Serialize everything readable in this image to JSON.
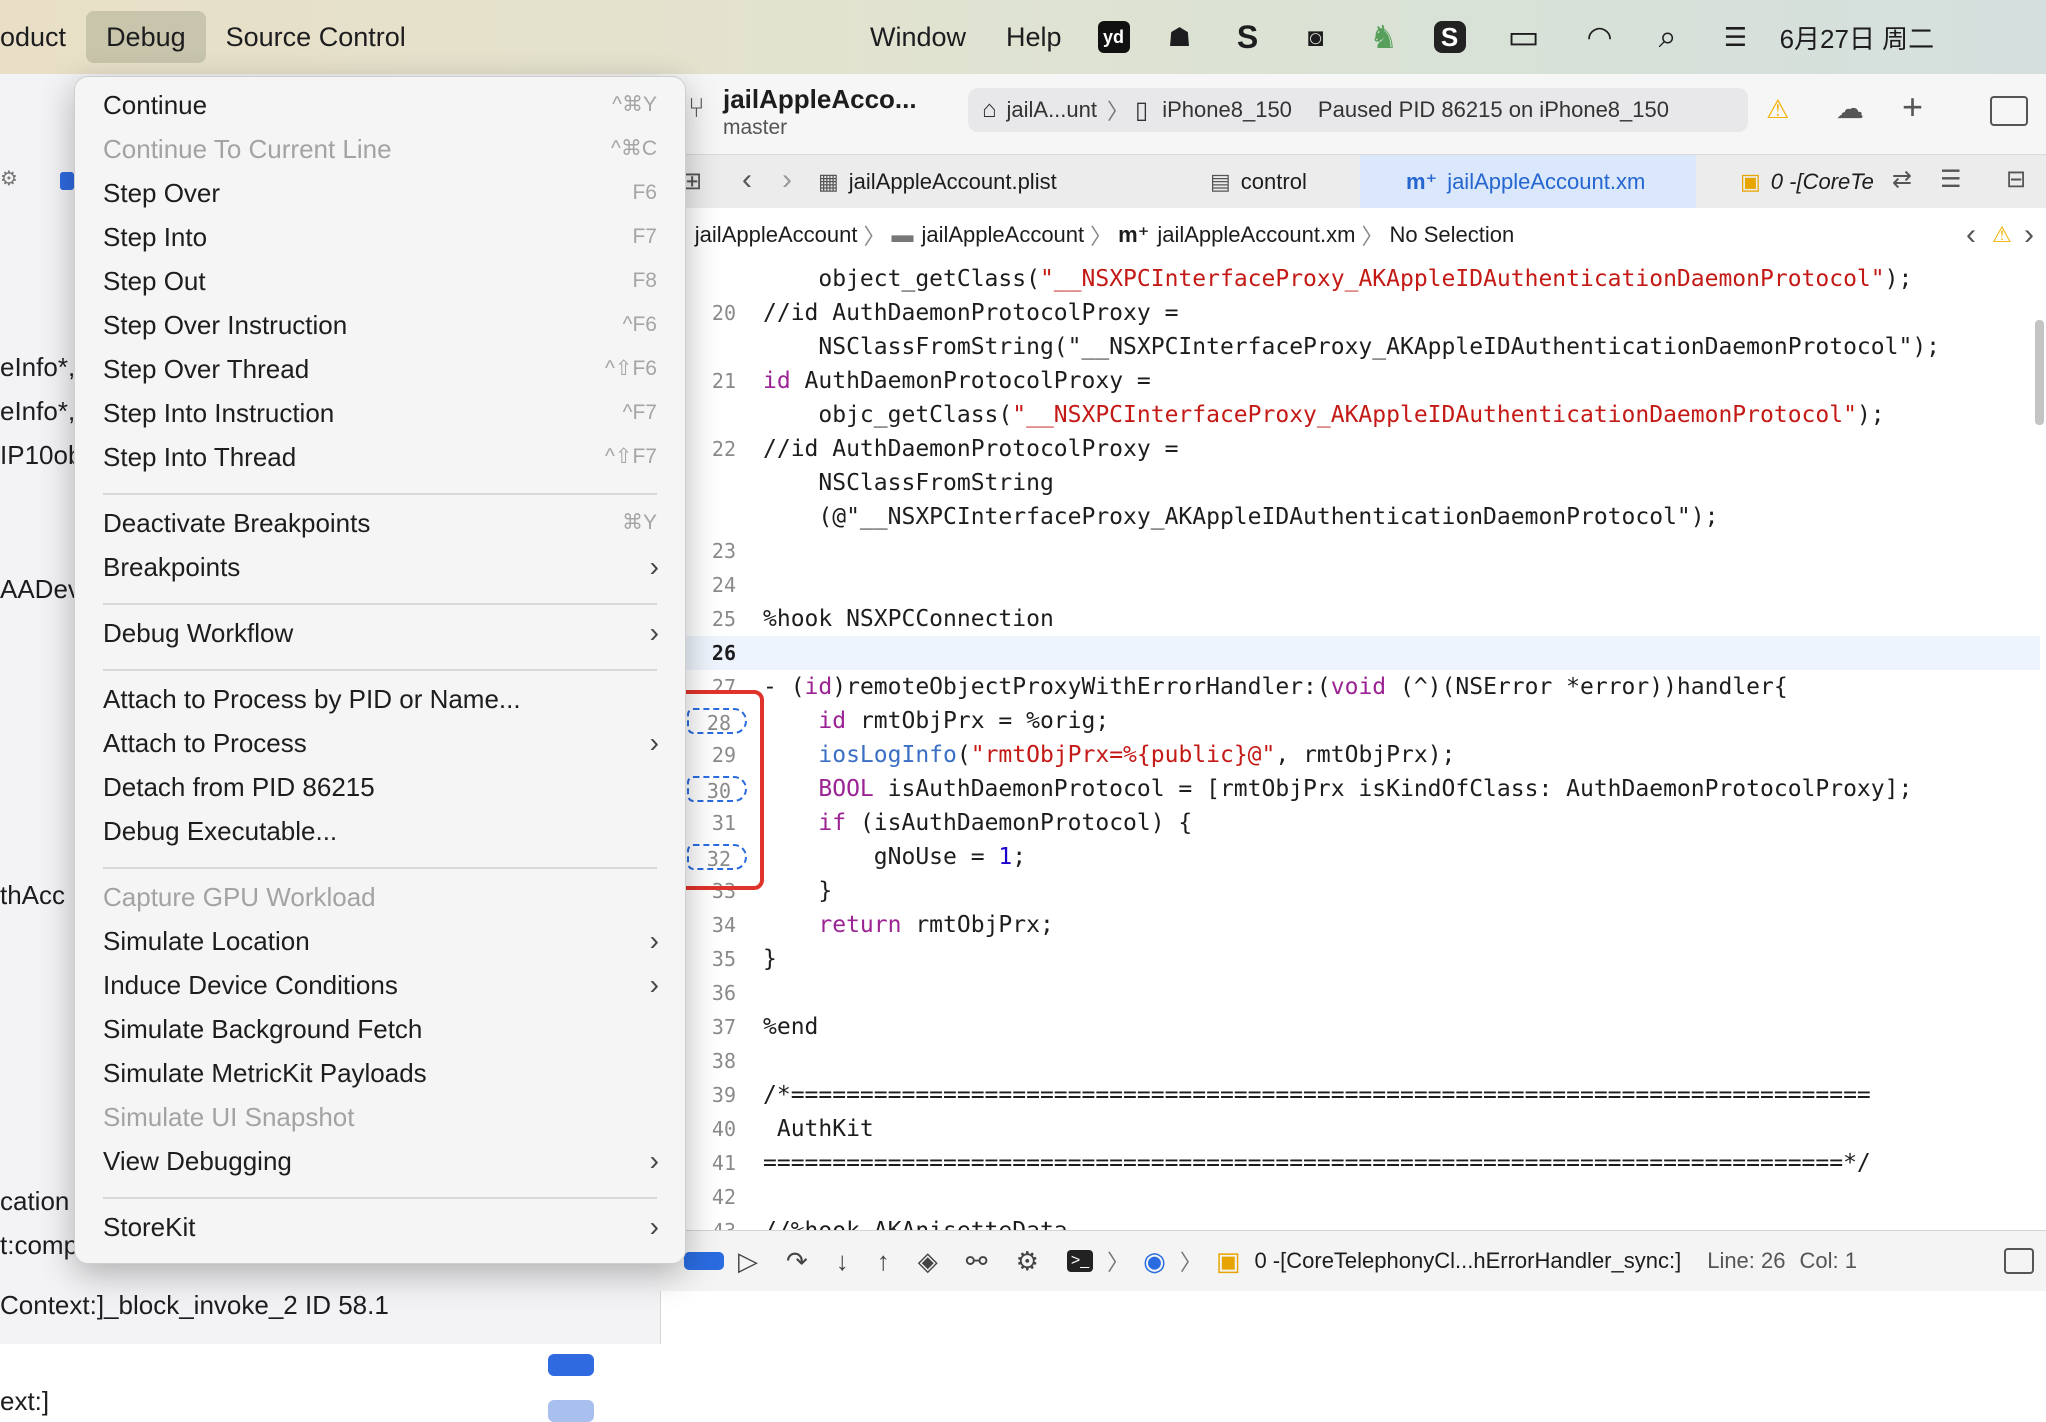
{
  "menubar": {
    "left_items": [
      {
        "label": "oduct",
        "active": false
      },
      {
        "label": "Debug",
        "active": true
      },
      {
        "label": "Source Control",
        "active": false
      }
    ],
    "right_items": [
      "Window",
      "Help"
    ],
    "tray_icons": [
      "youdao-icon",
      "moon-cup-icon",
      "s-app-icon",
      "wechat-icon",
      "horse-icon",
      "sogou-icon",
      "battery-icon",
      "wifi-icon",
      "search-icon",
      "control-center-icon"
    ],
    "tray_glyphs": [
      "yd",
      "☗",
      "S",
      "◙",
      "♞",
      "S",
      "▭",
      "◠",
      "⌕",
      "☰"
    ],
    "clock": "6月27日 周二"
  },
  "navigator": {
    "lines": [
      "eInfo*,",
      "eInfo*,",
      "IP10ob",
      "AADev",
      "thAcc",
      "cation",
      "t:comp",
      "Context:]_block_invoke_2  ID 58.1",
      "ext:]"
    ]
  },
  "toolbar": {
    "project_name": "jailAppleAcco...",
    "branch": "master",
    "scheme_target": "jailA...unt",
    "device": "iPhone8_150",
    "status": "Paused PID 86215 on iPhone8_150",
    "warning": "⚠",
    "add": "+"
  },
  "tabs": [
    {
      "label": "jailAppleAccount.plist",
      "icon": "▦"
    },
    {
      "label": "control",
      "icon": "▤"
    },
    {
      "label": "jailAppleAccount.xm",
      "icon": "m⁺"
    },
    {
      "label": "0 -[CoreTe",
      "icon": "▣"
    }
  ],
  "jumpbar": {
    "items": [
      "jailAppleAccount",
      "jailAppleAccount",
      "jailAppleAccount.xm",
      "No Selection"
    ],
    "sep": "〉"
  },
  "code": {
    "lines": [
      {
        "n": "",
        "text": "    object_getClass(\"__NSXPCInterfaceProxy_AKAppleIDAuthenticationDaemonProtocol\");"
      },
      {
        "n": "20",
        "text": "//id AuthDaemonProtocolProxy ="
      },
      {
        "n": "",
        "text": "    NSClassFromString(\"__NSXPCInterfaceProxy_AKAppleIDAuthenticationDaemonProtocol\");"
      },
      {
        "n": "21",
        "text": "id AuthDaemonProtocolProxy ="
      },
      {
        "n": "",
        "text": "    objc_getClass(\"__NSXPCInterfaceProxy_AKAppleIDAuthenticationDaemonProtocol\");"
      },
      {
        "n": "22",
        "text": "//id AuthDaemonProtocolProxy ="
      },
      {
        "n": "",
        "text": "    NSClassFromString"
      },
      {
        "n": "",
        "text": "    (@\"__NSXPCInterfaceProxy_AKAppleIDAuthenticationDaemonProtocol\");"
      },
      {
        "n": "23",
        "text": ""
      },
      {
        "n": "24",
        "text": ""
      },
      {
        "n": "25",
        "text": "%hook NSXPCConnection"
      },
      {
        "n": "26",
        "text": ""
      },
      {
        "n": "27",
        "text": "- (id)remoteObjectProxyWithErrorHandler:(void (^)(NSError *error))handler{"
      },
      {
        "n": "28",
        "text": "    id rmtObjPrx = %orig;"
      },
      {
        "n": "29",
        "text": "    iosLogInfo(\"rmtObjPrx=%{public}@\", rmtObjPrx);"
      },
      {
        "n": "30",
        "text": "    BOOL isAuthDaemonProtocol = [rmtObjPrx isKindOfClass: AuthDaemonProtocolProxy];"
      },
      {
        "n": "31",
        "text": "    if (isAuthDaemonProtocol) {"
      },
      {
        "n": "32",
        "text": "        gNoUse = 1;"
      },
      {
        "n": "33",
        "text": "    }"
      },
      {
        "n": "34",
        "text": "    return rmtObjPrx;"
      },
      {
        "n": "35",
        "text": "}"
      },
      {
        "n": "36",
        "text": ""
      },
      {
        "n": "37",
        "text": "%end"
      },
      {
        "n": "38",
        "text": ""
      },
      {
        "n": "39",
        "text": "/*=============================================================================="
      },
      {
        "n": "40",
        "text": " AuthKit"
      },
      {
        "n": "41",
        "text": "==============================================================================*/"
      },
      {
        "n": "42",
        "text": ""
      },
      {
        "n": "43",
        "text": "//%hook AKAnisetteData"
      }
    ]
  },
  "debugbar": {
    "frame": "0 -[CoreTelephonyCl...hErrorHandler_sync:]",
    "line": "Line: 26",
    "col": "Col: 1"
  },
  "debug_menu": {
    "items": [
      {
        "label": "Continue",
        "shortcut": "^⌘Y",
        "disabled": false,
        "submenu": false
      },
      {
        "label": "Continue To Current Line",
        "shortcut": "^⌘C",
        "disabled": true,
        "submenu": false
      },
      {
        "label": "Step Over",
        "shortcut": "F6",
        "disabled": false,
        "submenu": false
      },
      {
        "label": "Step Into",
        "shortcut": "F7",
        "disabled": false,
        "submenu": false
      },
      {
        "label": "Step Out",
        "shortcut": "F8",
        "disabled": false,
        "submenu": false
      },
      {
        "label": "Step Over Instruction",
        "shortcut": "^F6",
        "disabled": false,
        "submenu": false
      },
      {
        "label": "Step Over Thread",
        "shortcut": "^⇧F6",
        "disabled": false,
        "submenu": false
      },
      {
        "label": "Step Into Instruction",
        "shortcut": "^F7",
        "disabled": false,
        "submenu": false
      },
      {
        "label": "Step Into Thread",
        "shortcut": "^⇧F7",
        "disabled": false,
        "submenu": false
      },
      {
        "label": "Deactivate Breakpoints",
        "shortcut": "⌘Y",
        "disabled": false,
        "submenu": false
      },
      {
        "label": "Breakpoints",
        "shortcut": "",
        "disabled": false,
        "submenu": true
      },
      {
        "label": "Debug Workflow",
        "shortcut": "",
        "disabled": false,
        "submenu": true
      },
      {
        "label": "Attach to Process by PID or Name...",
        "shortcut": "",
        "disabled": false,
        "submenu": false
      },
      {
        "label": "Attach to Process",
        "shortcut": "",
        "disabled": false,
        "submenu": true
      },
      {
        "label": "Detach from PID 86215",
        "shortcut": "",
        "disabled": false,
        "submenu": false
      },
      {
        "label": "Debug Executable...",
        "shortcut": "",
        "disabled": false,
        "submenu": false
      },
      {
        "label": "Capture GPU Workload",
        "shortcut": "",
        "disabled": true,
        "submenu": false
      },
      {
        "label": "Simulate Location",
        "shortcut": "",
        "disabled": false,
        "submenu": true
      },
      {
        "label": "Induce Device Conditions",
        "shortcut": "",
        "disabled": false,
        "submenu": true
      },
      {
        "label": "Simulate Background Fetch",
        "shortcut": "",
        "disabled": false,
        "submenu": false
      },
      {
        "label": "Simulate MetricKit Payloads",
        "shortcut": "",
        "disabled": false,
        "submenu": false
      },
      {
        "label": "Simulate UI Snapshot",
        "shortcut": "",
        "disabled": true,
        "submenu": false
      },
      {
        "label": "View Debugging",
        "shortcut": "",
        "disabled": false,
        "submenu": true
      },
      {
        "label": "StoreKit",
        "shortcut": "",
        "disabled": false,
        "submenu": true
      }
    ],
    "chevron": "›"
  },
  "colors": {
    "accent": "#2a6be0",
    "highlight_red": "#e0332b",
    "keyword": "#9b2393",
    "string": "#c41a16"
  }
}
